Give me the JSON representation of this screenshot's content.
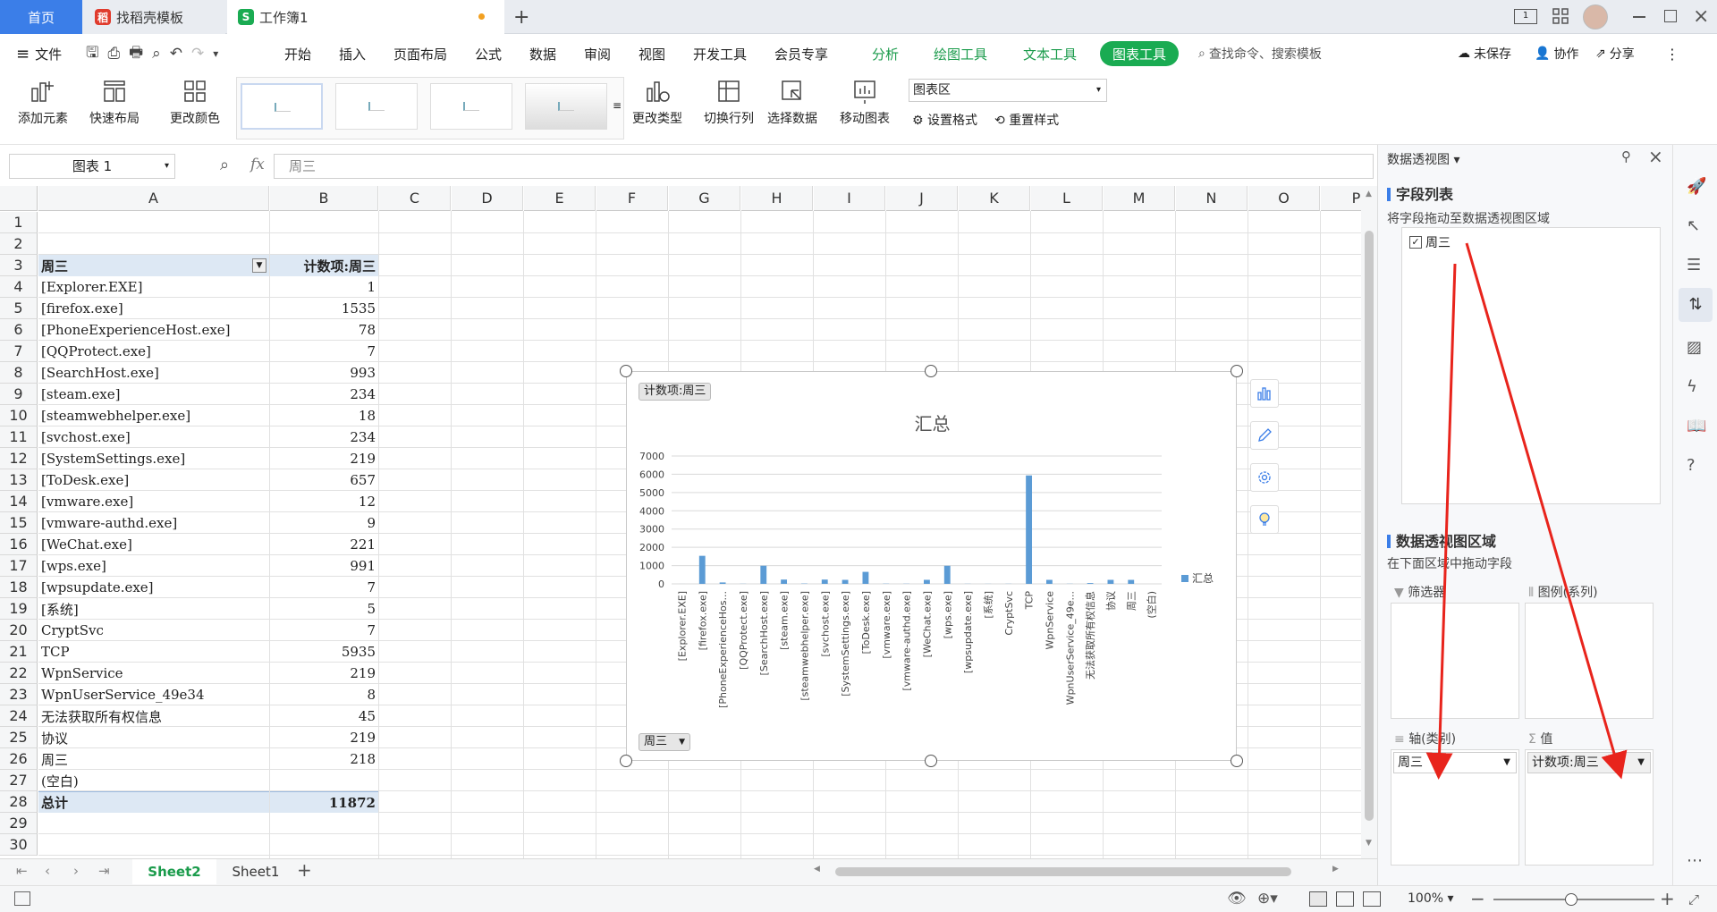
{
  "tabs": [
    {
      "label": "首页"
    },
    {
      "label": "找稻壳模板"
    },
    {
      "label": "工作簿1"
    }
  ],
  "menu": {
    "file": "文件",
    "items": [
      "开始",
      "插入",
      "页面布局",
      "公式",
      "数据",
      "审阅",
      "视图",
      "开发工具",
      "会员专享",
      "分析",
      "绘图工具",
      "文本工具",
      "图表工具"
    ],
    "search": "查找命令、搜索模板",
    "unsaved": "未保存",
    "collab": "协作",
    "share": "分享"
  },
  "ribbon": {
    "add_element": "添加元素",
    "quick_layout": "快速布局",
    "change_color": "更改颜色",
    "change_type": "更改类型",
    "switch_rowcol": "切换行列",
    "select_data": "选择数据",
    "move_chart": "移动图表",
    "chart_area": "图表区",
    "set_format": "设置格式",
    "reset_style": "重置样式"
  },
  "formula_bar": {
    "name_box": "图表 1",
    "fx": "fx",
    "content": "周三"
  },
  "columns": [
    "A",
    "B",
    "C",
    "D",
    "E",
    "F",
    "G",
    "H",
    "I",
    "J",
    "K",
    "L",
    "M",
    "N",
    "O",
    "P"
  ],
  "rows": [
    {
      "n": "1",
      "a": "",
      "b": ""
    },
    {
      "n": "2",
      "a": "",
      "b": ""
    },
    {
      "n": "3",
      "a": "周三",
      "b": "计数项:周三",
      "header": true
    },
    {
      "n": "4",
      "a": "[Explorer.EXE]",
      "b": "1"
    },
    {
      "n": "5",
      "a": "[firefox.exe]",
      "b": "1535"
    },
    {
      "n": "6",
      "a": "[PhoneExperienceHost.exe]",
      "b": "78"
    },
    {
      "n": "7",
      "a": "[QQProtect.exe]",
      "b": "7"
    },
    {
      "n": "8",
      "a": "[SearchHost.exe]",
      "b": "993"
    },
    {
      "n": "9",
      "a": "[steam.exe]",
      "b": "234"
    },
    {
      "n": "10",
      "a": "[steamwebhelper.exe]",
      "b": "18"
    },
    {
      "n": "11",
      "a": "[svchost.exe]",
      "b": "234"
    },
    {
      "n": "12",
      "a": "[SystemSettings.exe]",
      "b": "219"
    },
    {
      "n": "13",
      "a": "[ToDesk.exe]",
      "b": "657"
    },
    {
      "n": "14",
      "a": "[vmware.exe]",
      "b": "12"
    },
    {
      "n": "15",
      "a": "[vmware-authd.exe]",
      "b": "9"
    },
    {
      "n": "16",
      "a": "[WeChat.exe]",
      "b": "221"
    },
    {
      "n": "17",
      "a": "[wps.exe]",
      "b": "991"
    },
    {
      "n": "18",
      "a": "[wpsupdate.exe]",
      "b": "7"
    },
    {
      "n": "19",
      "a": "[系统]",
      "b": "5"
    },
    {
      "n": "20",
      "a": "CryptSvc",
      "b": "7"
    },
    {
      "n": "21",
      "a": "TCP",
      "b": "5935"
    },
    {
      "n": "22",
      "a": "WpnService",
      "b": "219"
    },
    {
      "n": "23",
      "a": "WpnUserService_49e34",
      "b": "8"
    },
    {
      "n": "24",
      "a": "无法获取所有权信息",
      "b": "45"
    },
    {
      "n": "25",
      "a": "协议",
      "b": "219"
    },
    {
      "n": "26",
      "a": "周三",
      "b": "218"
    },
    {
      "n": "27",
      "a": "(空白)",
      "b": ""
    },
    {
      "n": "28",
      "a": "总计",
      "b": "11872",
      "total": true
    },
    {
      "n": "29",
      "a": "",
      "b": ""
    },
    {
      "n": "30",
      "a": "",
      "b": ""
    }
  ],
  "chart_data": {
    "type": "bar",
    "title": "汇总",
    "field_button": "计数项:周三",
    "axis_button": "周三",
    "categories": [
      "[Explorer.EXE]",
      "[firefox.exe]",
      "[PhoneExperienceHos...",
      "[QQProtect.exe]",
      "[SearchHost.exe]",
      "[steam.exe]",
      "[steamwebhelper.exe]",
      "[svchost.exe]",
      "[SystemSettings.exe]",
      "[ToDesk.exe]",
      "[vmware.exe]",
      "[vmware-authd.exe]",
      "[WeChat.exe]",
      "[wps.exe]",
      "[wpsupdate.exe]",
      "[系统]",
      "CryptSvc",
      "TCP",
      "WpnService",
      "WpnUserService_49e...",
      "无法获取所有权信息",
      "协议",
      "周三",
      "(空白)"
    ],
    "series": [
      {
        "name": "汇总",
        "values": [
          1,
          1535,
          78,
          7,
          993,
          234,
          18,
          234,
          219,
          657,
          12,
          9,
          221,
          991,
          7,
          5,
          7,
          5935,
          219,
          8,
          45,
          219,
          218,
          0
        ]
      }
    ],
    "yticks": [
      "0",
      "1000",
      "2000",
      "3000",
      "4000",
      "5000",
      "6000",
      "7000"
    ],
    "ylim": [
      0,
      7000
    ],
    "color": "#5b9bd5",
    "legend": "right"
  },
  "sheets": {
    "active": "Sheet2",
    "other": "Sheet1"
  },
  "panel": {
    "title": "数据透视图",
    "field_list": "字段列表",
    "drag_hint": "将字段拖动至数据透视图区域",
    "field": "周三",
    "area_title": "数据透视图区域",
    "area_hint": "在下面区域中拖动字段",
    "filter": "筛选器",
    "legend": "图例(系列)",
    "axis": "轴(类别)",
    "values": "值",
    "axis_item": "周三",
    "value_item": "计数项:周三"
  },
  "status": {
    "zoom": "100%"
  }
}
